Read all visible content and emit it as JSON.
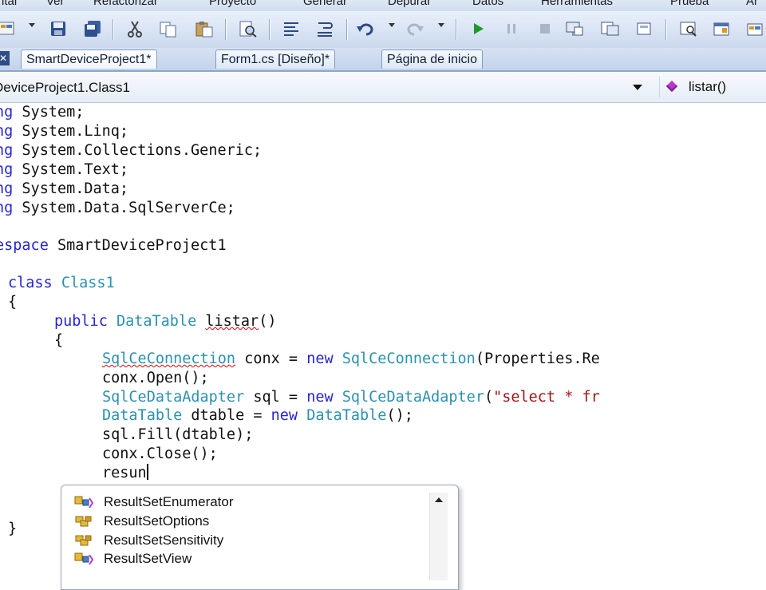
{
  "menu": {
    "items": [
      "ital",
      "Ver",
      "Refactorizar",
      "Proyecto",
      "Generar",
      "Depurar",
      "Datos",
      "Herramientas",
      "Prueba",
      "Ar"
    ]
  },
  "tabs": [
    {
      "label": "SmartDeviceProject1*",
      "active": true
    },
    {
      "label": "Form1.cs [Diseño]*",
      "active": false
    },
    {
      "label": "Página de inicio",
      "active": false
    }
  ],
  "navbar": {
    "class_selector": "DeviceProject1.Class1",
    "member_selector": "listar()"
  },
  "code": {
    "line1": {
      "kw": "ng",
      "rest": " System;"
    },
    "line2": {
      "kw": "ng",
      "rest": " System.Linq;"
    },
    "line3": {
      "kw": "ng",
      "rest": " System.Collections.Generic;"
    },
    "line4": {
      "kw": "ng",
      "rest": " System.Text;"
    },
    "line5": {
      "kw": "ng",
      "rest": " System.Data;"
    },
    "line6": {
      "kw": "ng",
      "rest": " System.Data.SqlServerCe;"
    },
    "line7": {
      "kw": "espace",
      "rest": " SmartDeviceProject1"
    },
    "line8": {
      "kw": "class",
      "type": "Class1"
    },
    "line9": "{",
    "line10": {
      "kw": "public",
      "type": "DataTable",
      "name": "listar",
      "rest": "()"
    },
    "line11": "{",
    "line12": {
      "type1": "SqlCeConnection",
      "mid": " conx = ",
      "kw": "new",
      "type2": "SqlCeConnection",
      "rest": "(Properties.Re"
    },
    "line13": "conx.Open();",
    "line14": {
      "type1": "SqlCeDataAdapter",
      "mid": " sql = ",
      "kw": "new",
      "type2": "SqlCeDataAdapter",
      "open": "(",
      "str": "\"select * fr"
    },
    "line15": {
      "type1": "DataTable",
      "mid": " dtable = ",
      "kw": "new",
      "type2": "DataTable",
      "rest": "();"
    },
    "line16": "sql.Fill(dtable);",
    "line17": "conx.Close();",
    "line18": "resun",
    "line19": "}"
  },
  "completion": {
    "items": [
      {
        "label": "ResultSetEnumerator",
        "icon": "class-icon"
      },
      {
        "label": "ResultSetOptions",
        "icon": "enum-icon"
      },
      {
        "label": "ResultSetSensitivity",
        "icon": "enum-icon"
      },
      {
        "label": "ResultSetView",
        "icon": "class-icon"
      }
    ]
  },
  "colors": {
    "keyword": "#2525d6",
    "type": "#2b91af",
    "string": "#a31515",
    "toolbar": "#cbd9ee"
  }
}
